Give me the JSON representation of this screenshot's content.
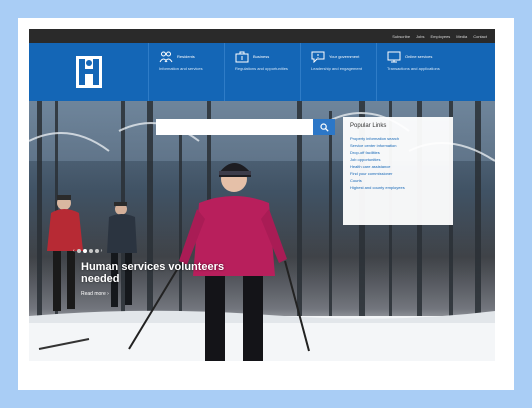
{
  "utility_links": [
    "Subscribe",
    "Jobs",
    "Employees",
    "Media",
    "Contact"
  ],
  "nav": {
    "items": [
      {
        "title": "Residents",
        "subtitle": "Information and services",
        "icon": "people-icon"
      },
      {
        "title": "Business",
        "subtitle": "Regulations and opportunities",
        "icon": "briefcase-icon"
      },
      {
        "title": "Your government",
        "subtitle": "Leadership and engagement",
        "icon": "speech-bubble-icon"
      },
      {
        "title": "Online services",
        "subtitle": "Transactions and applications",
        "icon": "monitor-icon"
      }
    ]
  },
  "search": {
    "placeholder": "",
    "value": ""
  },
  "popular_links": {
    "title": "Popular Links",
    "items": [
      "Property information search",
      "Service center information",
      "Drop-off facilities",
      "Job opportunities",
      "Health care assistance",
      "Find your commissioner",
      "Courts",
      "Highest and county employees"
    ]
  },
  "hero": {
    "headline": "Human services volunteers needed",
    "read_more": "Read more ›",
    "carousel": {
      "total": 4,
      "active": 2
    }
  },
  "colors": {
    "page_bg": "#a9cdf5",
    "nav_blue": "#1466b6",
    "util_bar": "#2a2a2a",
    "search_button": "#2c77c7"
  }
}
